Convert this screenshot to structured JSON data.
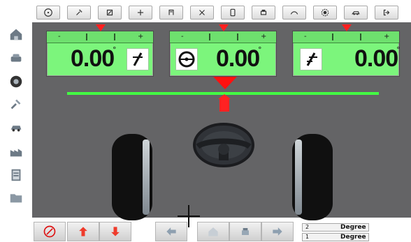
{
  "measurements": {
    "left": {
      "value": "0.00",
      "unit": "°"
    },
    "center": {
      "value": "0.00",
      "unit": "°"
    },
    "right": {
      "value": "0.00",
      "unit": "°"
    }
  },
  "legend": {
    "row1": {
      "number": "2",
      "label": "Degree"
    },
    "row2": {
      "number": "1",
      "label": "Degree"
    }
  },
  "colors": {
    "panel_fill": "#7cf57c",
    "panel_header": "#6ee06e",
    "work_area": "#646466",
    "center_line": "#43ff43",
    "red_marker": "#ff1010"
  },
  "icons": {
    "sidebar": [
      "home-icon",
      "vehicle-lift-icon",
      "tire-icon",
      "tools-icon",
      "car-icon",
      "factory-icon",
      "report-icon",
      "folder-icon"
    ],
    "toolbar": [
      "steering-mode-icon",
      "tool-icon",
      "adjust-icon",
      "compare-icon",
      "caster-icon",
      "toe-icon",
      "wheel-icon",
      "print-icon",
      "curve-icon",
      "settings-icon",
      "car-side-icon",
      "exit-icon"
    ],
    "bottom": [
      "stop-icon",
      "arrow-up-icon",
      "arrow-down-icon",
      "arrow-left-icon",
      "home-icon",
      "printer-icon",
      "arrow-right-icon"
    ]
  }
}
